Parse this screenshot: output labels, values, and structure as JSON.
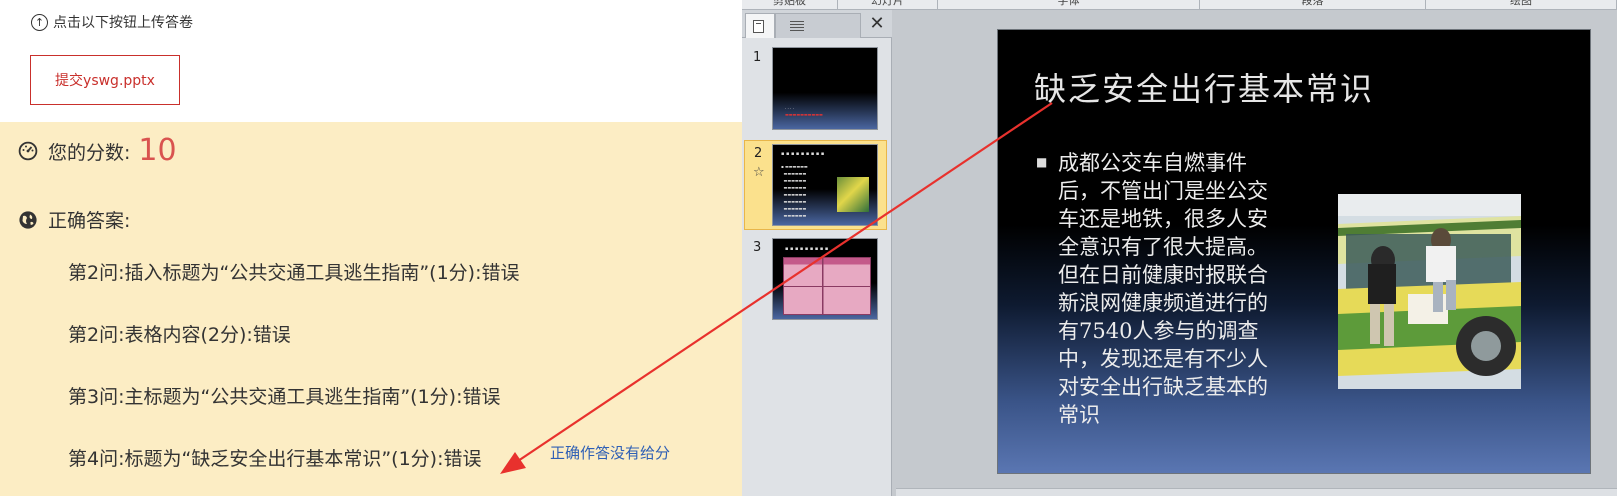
{
  "upload": {
    "hint": "点击以下按钮上传答卷",
    "submit_label": "提交yswg.pptx"
  },
  "result": {
    "score_label": "您的分数:",
    "score_value": "10",
    "answer_label": "正确答案:",
    "items": [
      "第2问:插入标题为“公共交通工具逃生指南”(1分):错误",
      "第2问:表格内容(2分):错误",
      "第3问:主标题为“公共交通工具逃生指南”(1分):错误",
      "第4问:标题为“缺乏安全出行基本常识”(1分):错误"
    ],
    "annotation": "正确作答没有给分"
  },
  "ppt": {
    "ribbon_groups": [
      "剪贴板",
      "幻灯片",
      "字体",
      "段落",
      "绘图"
    ],
    "slides": [
      {
        "number": "1"
      },
      {
        "number": "2"
      },
      {
        "number": "3"
      }
    ],
    "current_slide": {
      "title": "缺乏安全出行基本常识",
      "body": "成都公交车自燃事件后，不管出门是坐公交车还是地铁，很多人安全意识有了很大提高。但在日前健康时报联合新浪网健康频道进行的有7540人参与的调查中，发现还是有不少人对安全出行缺乏基本的常识"
    }
  },
  "colors": {
    "result_bg": "#fcedc4",
    "score_red": "#d9534f",
    "arrow_red": "#e8312d",
    "note_blue": "#2e5fb5",
    "selected_thumb": "#fbe18d"
  },
  "icons": {
    "upload": "upload-circle-icon",
    "score": "dashboard-icon",
    "answer": "globe-icon",
    "pane_close": "close-icon"
  }
}
